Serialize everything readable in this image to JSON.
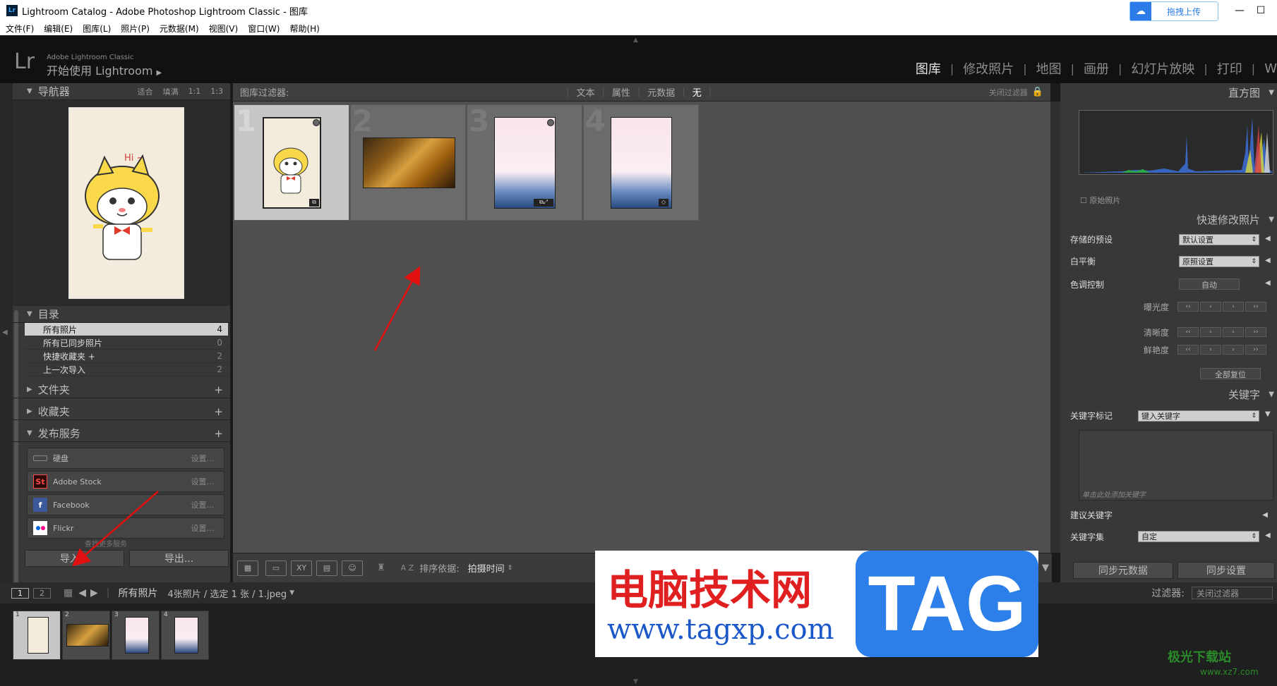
{
  "window": {
    "title": "Lightroom Catalog - Adobe Photoshop Lightroom Classic - 图库",
    "lr_icon": "Lr",
    "upload": "拖拽上传"
  },
  "menu": [
    "文件(F)",
    "编辑(E)",
    "图库(L)",
    "照片(P)",
    "元数据(M)",
    "视图(V)",
    "窗口(W)",
    "帮助(H)"
  ],
  "identity": {
    "logo": "Lr",
    "brand": "Adobe Lightroom Classic",
    "getstarted": "开始使用 Lightroom"
  },
  "modules": [
    "图库",
    "修改照片",
    "地图",
    "画册",
    "幻灯片放映",
    "打印",
    "W"
  ],
  "navigator": {
    "title": "导航器",
    "fit": "适合",
    "fill": "填满",
    "r1": "1:1",
    "r2": "1:3"
  },
  "catalog": {
    "title": "目录",
    "items": [
      {
        "label": "所有照片",
        "count": "4"
      },
      {
        "label": "所有已同步照片",
        "count": "0"
      },
      {
        "label": "快捷收藏夹 +",
        "count": "2"
      },
      {
        "label": "上一次导入",
        "count": "2"
      }
    ]
  },
  "folders": "文件夹",
  "collections": "收藏夹",
  "publish": {
    "title": "发布服务",
    "items": [
      {
        "label": "硬盘",
        "set": "设置..."
      },
      {
        "label": "Adobe Stock",
        "set": "设置..."
      },
      {
        "label": "Facebook",
        "set": "设置..."
      },
      {
        "label": "Flickr",
        "set": "设置..."
      }
    ],
    "more": "查找更多服务"
  },
  "import_btn": "导入...",
  "export_btn": "导出...",
  "filter": {
    "label": "图库过滤器:",
    "text": "文本",
    "attr": "属性",
    "meta": "元数据",
    "none": "无",
    "close": "关闭过滤器"
  },
  "grid": {
    "numbers": [
      "1",
      "2",
      "3",
      "4"
    ],
    "hi": "Hi ~"
  },
  "toolbar": {
    "sort_label": "排序依据:",
    "sort_value": "拍摄时间",
    "az": "A Z"
  },
  "right": {
    "histogram": "直方图",
    "original": "原始照片",
    "quick": "快速修改照片",
    "preset_label": "存储的预设",
    "preset_value": "默认设置",
    "wb_label": "白平衡",
    "wb_value": "原照设置",
    "tone_label": "色调控制",
    "auto": "自动",
    "exposure": "曝光度",
    "clarity": "清晰度",
    "vibrance": "鲜艳度",
    "reset": "全部复位",
    "keywords": "关键字",
    "kw_tags": "关键字标记",
    "kw_input": "键入关键字",
    "kw_hint": "单击此处添加关键字",
    "suggest": "建议关键字",
    "kw_set": "关键字集",
    "kw_set_value": "自定",
    "sync_meta": "同步元数据",
    "sync_set": "同步设置"
  },
  "filmstrip": {
    "p1": "1",
    "p2": "2",
    "source": "所有照片",
    "info": "4张照片 / 选定 1 张 / 1.jpeg",
    "filter_label": "过滤器:",
    "filter_value": "关闭过滤器",
    "numbers": [
      "1",
      "2",
      "3",
      "4"
    ]
  },
  "watermark": {
    "text": "电脑技术网",
    "url": "www.tagxp.com",
    "tag": "TAG",
    "site": "极光下载站",
    "site_url": "www.xz7.com"
  }
}
